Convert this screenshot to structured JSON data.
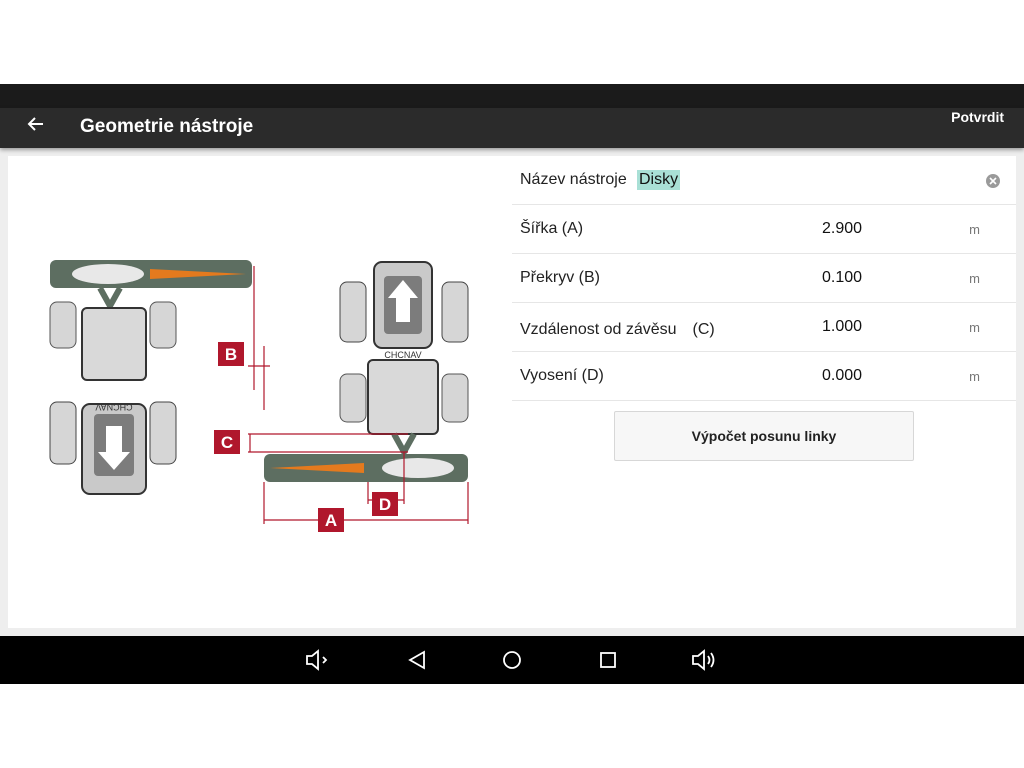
{
  "appbar": {
    "title": "Geometrie nástroje",
    "confirm_label": "Potvrdit",
    "back_icon": "arrow-left-icon"
  },
  "form": {
    "name_label": "Název nástroje",
    "name_value": "Disky",
    "rows": [
      {
        "label": "Šířka (A)",
        "value": "2.900",
        "unit": "m"
      },
      {
        "label": "Překryv (B)",
        "value": "0.100",
        "unit": "m"
      },
      {
        "label": "Vzdálenost od závěsu　(C)",
        "value": "1.000",
        "unit": "m"
      },
      {
        "label": "Vyosení (D)",
        "value": "0.000",
        "unit": "m"
      }
    ],
    "calc_button": "Výpočet posunu linky"
  },
  "diagram": {
    "brand": "CHCNAV",
    "labels": {
      "a": "A",
      "b": "B",
      "c": "C",
      "d": "D"
    },
    "accent_color": "#b0172c"
  },
  "navbar": {
    "icons": [
      "volume-down-icon",
      "back-triangle-icon",
      "home-circle-icon",
      "recents-square-icon",
      "volume-up-icon"
    ]
  }
}
